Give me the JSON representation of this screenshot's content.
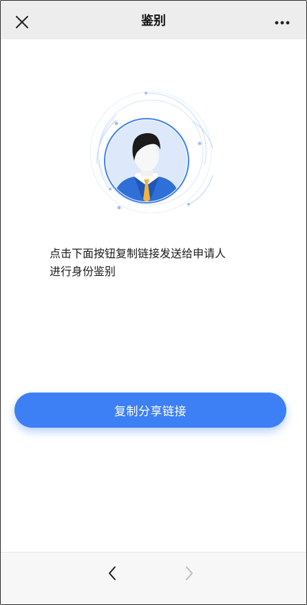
{
  "header": {
    "title": "鉴别",
    "close_icon": "close-icon",
    "more_icon": "more-dots-icon"
  },
  "illustration": {
    "icon": "person-avatar-icon",
    "accent": "#3d7ff5"
  },
  "instruction": {
    "line1": "点击下面按钮复制链接发送给申请人",
    "line2": "进行身份鉴别"
  },
  "actions": {
    "share_label": "复制分享链接",
    "accent": "#3d7ff5"
  },
  "bottom_nav": {
    "back_icon": "chevron-left-icon",
    "forward_icon": "chevron-right-icon"
  }
}
